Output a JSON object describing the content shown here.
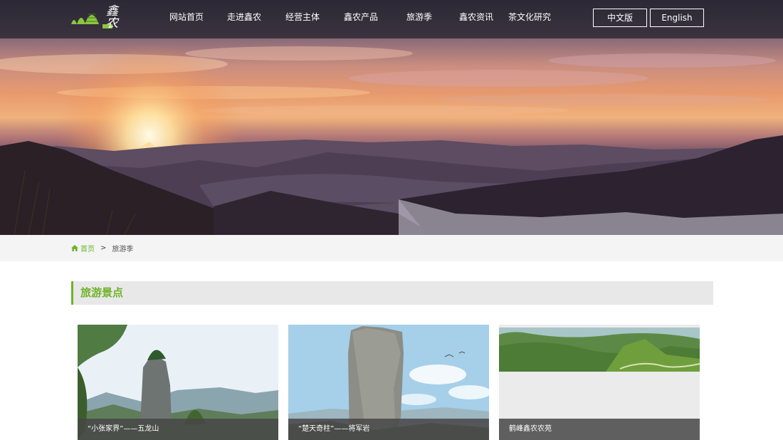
{
  "header": {
    "logo_text": "鑫农",
    "nav": [
      {
        "label": "网站首页"
      },
      {
        "label": "走进鑫农"
      },
      {
        "label": "经营主体"
      },
      {
        "label": "鑫农产品"
      },
      {
        "label": "旅游季"
      },
      {
        "label": "鑫农资讯"
      },
      {
        "label": "茶文化研究"
      }
    ],
    "lang": {
      "chinese": "中文版",
      "english": "English"
    }
  },
  "breadcrumb": {
    "home": "首页",
    "separator": ">",
    "current": "旅游季"
  },
  "section": {
    "title": "旅游景点"
  },
  "cards": [
    {
      "caption": "“小张家界”——五龙山"
    },
    {
      "caption": "“楚天奇柱”——将军岩"
    },
    {
      "caption": "鹤峰鑫农农苑"
    }
  ],
  "colors": {
    "accent": "#6fb22a",
    "header_bg": "#26242e",
    "breadcrumb_bg": "#f4f4f4",
    "section_bg": "#e8e8e8"
  }
}
